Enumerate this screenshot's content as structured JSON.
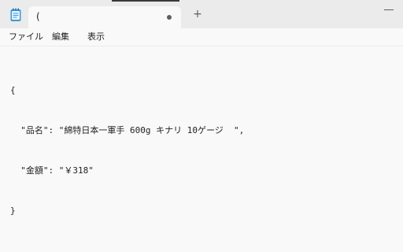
{
  "tab": {
    "title": "(",
    "unsaved": true
  },
  "titlebar": {
    "new_tab_label": "+"
  },
  "menu": {
    "file": "ファイル",
    "edit": "編集",
    "view": "表示"
  },
  "editor": {
    "lines": [
      "{",
      "  \"品名\": \"綿特日本一軍手 600g キナリ 10ゲージ  \",",
      "  \"金額\": \"￥318\"",
      "}"
    ]
  },
  "colors": {
    "titlebar_bg": "#ebebeb",
    "editor_bg": "#f9f9f9",
    "icon_blue": "#3b9ad9"
  }
}
